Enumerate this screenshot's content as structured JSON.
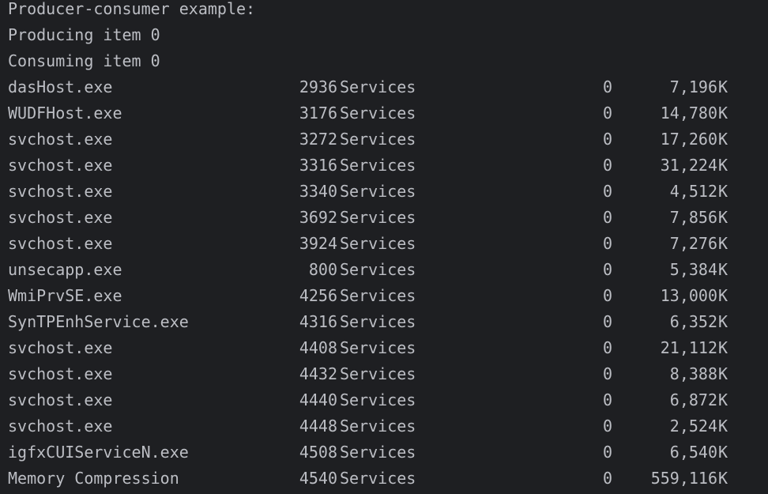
{
  "console": {
    "header_lines": [
      "Producer-consumer example:",
      "Producing item 0",
      "Consuming item 0"
    ],
    "processes": [
      {
        "name": "dasHost.exe",
        "pid": "2936",
        "session": "Services",
        "session_num": "0",
        "mem": "7,196",
        "unit": "K"
      },
      {
        "name": "WUDFHost.exe",
        "pid": "3176",
        "session": "Services",
        "session_num": "0",
        "mem": "14,780",
        "unit": "K"
      },
      {
        "name": "svchost.exe",
        "pid": "3272",
        "session": "Services",
        "session_num": "0",
        "mem": "17,260",
        "unit": "K"
      },
      {
        "name": "svchost.exe",
        "pid": "3316",
        "session": "Services",
        "session_num": "0",
        "mem": "31,224",
        "unit": "K"
      },
      {
        "name": "svchost.exe",
        "pid": "3340",
        "session": "Services",
        "session_num": "0",
        "mem": "4,512",
        "unit": "K"
      },
      {
        "name": "svchost.exe",
        "pid": "3692",
        "session": "Services",
        "session_num": "0",
        "mem": "7,856",
        "unit": "K"
      },
      {
        "name": "svchost.exe",
        "pid": "3924",
        "session": "Services",
        "session_num": "0",
        "mem": "7,276",
        "unit": "K"
      },
      {
        "name": "unsecapp.exe",
        "pid": "800",
        "session": "Services",
        "session_num": "0",
        "mem": "5,384",
        "unit": "K"
      },
      {
        "name": "WmiPrvSE.exe",
        "pid": "4256",
        "session": "Services",
        "session_num": "0",
        "mem": "13,000",
        "unit": "K"
      },
      {
        "name": "SynTPEnhService.exe",
        "pid": "4316",
        "session": "Services",
        "session_num": "0",
        "mem": "6,352",
        "unit": "K"
      },
      {
        "name": "svchost.exe",
        "pid": "4408",
        "session": "Services",
        "session_num": "0",
        "mem": "21,112",
        "unit": "K"
      },
      {
        "name": "svchost.exe",
        "pid": "4432",
        "session": "Services",
        "session_num": "0",
        "mem": "8,388",
        "unit": "K"
      },
      {
        "name": "svchost.exe",
        "pid": "4440",
        "session": "Services",
        "session_num": "0",
        "mem": "6,872",
        "unit": "K"
      },
      {
        "name": "svchost.exe",
        "pid": "4448",
        "session": "Services",
        "session_num": "0",
        "mem": "2,524",
        "unit": "K"
      },
      {
        "name": "igfxCUIServiceN.exe",
        "pid": "4508",
        "session": "Services",
        "session_num": "0",
        "mem": "6,540",
        "unit": "K"
      },
      {
        "name": "Memory Compression",
        "pid": "4540",
        "session": "Services",
        "session_num": "0",
        "mem": "559,116",
        "unit": "K"
      }
    ]
  }
}
